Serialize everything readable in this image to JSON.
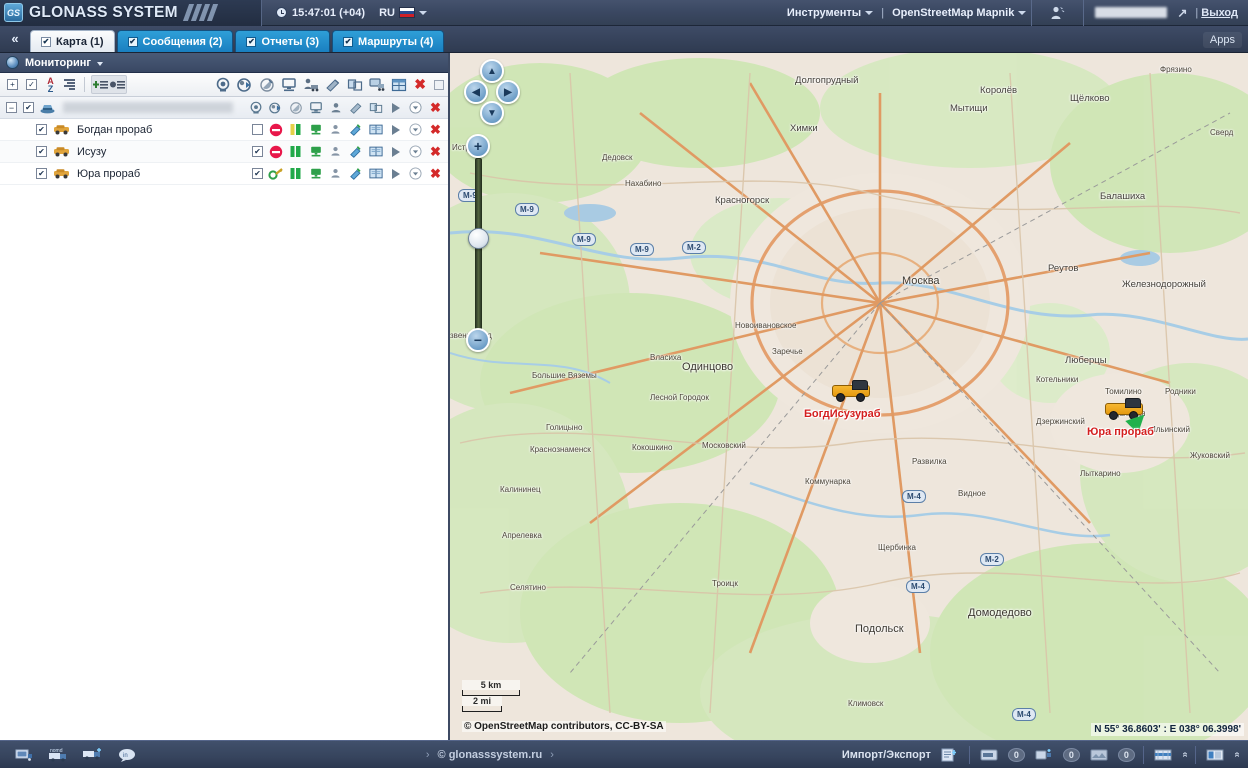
{
  "header": {
    "logo_text": "GLONASS SYSTEM",
    "logo_badge": "GS",
    "clock": "15:47:01 (+04)",
    "clock_icon": "clock-icon",
    "language": "RU",
    "flag_icon": "russia-flag-icon",
    "tools_menu": "Инструменты",
    "menu_divider": "|",
    "map_source_menu": "OpenStreetMap Mapnik",
    "user_tool_icon": "user-settings-icon",
    "user_name_redacted": "",
    "expand_icon": "expand-arrow-icon",
    "logout": "Выход"
  },
  "tabbar": {
    "collapse_icon": "collapse-left-icon",
    "tabs": [
      {
        "label": "Карта (1)",
        "checked": "✔",
        "active": true
      },
      {
        "label": "Сообщения (2)",
        "checked": "✔",
        "active": false
      },
      {
        "label": "Отчеты (3)",
        "checked": "✔",
        "active": false
      },
      {
        "label": "Маршруты (4)",
        "checked": "✔",
        "active": false
      }
    ],
    "apps_label": "Apps"
  },
  "panel": {
    "title": "Мониторинг",
    "globe_icon": "globe-icon",
    "caret_icon": "caret-down-icon",
    "toolbar_left": [
      {
        "name": "expand-all-button",
        "glyph": "⊞"
      },
      {
        "name": "select-all-checkbox-button",
        "glyph": "✔"
      },
      {
        "name": "sort-az-button",
        "glyph": "AZ"
      },
      {
        "name": "group-lines-button",
        "glyph": "lines"
      }
    ],
    "toolbar_groups": [
      {
        "name": "add-item-button",
        "glyph": "+"
      },
      {
        "name": "filter-item-button",
        "glyph": "●"
      }
    ],
    "toolbar_right": [
      {
        "name": "camera-monitor-icon"
      },
      {
        "name": "command-send-icon"
      },
      {
        "name": "satellite-antenna-icon"
      },
      {
        "name": "monitor-screen-icon"
      },
      {
        "name": "driver-truck-icon"
      },
      {
        "name": "fuel-sensor-icon"
      },
      {
        "name": "windows-copy-icon"
      },
      {
        "name": "truck-screen-icon"
      },
      {
        "name": "table-grid-icon"
      },
      {
        "name": "delete-all-icon"
      },
      {
        "name": "resize-corner-icon"
      }
    ]
  },
  "tree": {
    "group": {
      "expander": "−",
      "checked": "✔",
      "icon": "group-vehicles-icon",
      "name_redacted": "",
      "icons": [
        "camera-icon",
        "command-icon",
        "antenna-icon",
        "monitor-icon",
        "driver-icon",
        "fuel-icon",
        "copy-icon",
        "play-icon",
        "dropdown-icon",
        "delete-icon"
      ]
    },
    "items": [
      {
        "checked": "✔",
        "icon": "vehicle-icon",
        "label": "Богдан прораб",
        "second_checkbox": "",
        "status": "blocked",
        "status_icon": "no-entry-icon",
        "bars_icon": "signal-bars-icon",
        "monitor_icon": "monitor-green-icon",
        "driver_icon": "driver-icon",
        "fuel_icon": "fuel-sensor-icon",
        "book_icon": "book-open-icon",
        "play_icon": "play-icon",
        "dropdown_icon": "dropdown-icon",
        "delete_icon": "delete-icon"
      },
      {
        "checked": "✔",
        "icon": "vehicle-icon",
        "label": "Исузу",
        "second_checkbox": "✔",
        "status": "blocked",
        "status_icon": "no-entry-icon",
        "bars_icon": "signal-bars-icon",
        "monitor_icon": "monitor-green-icon",
        "driver_icon": "driver-icon",
        "fuel_icon": "fuel-sensor-icon",
        "book_icon": "book-open-icon",
        "play_icon": "play-icon",
        "dropdown_icon": "dropdown-icon",
        "delete_icon": "delete-icon"
      },
      {
        "checked": "✔",
        "icon": "vehicle-icon",
        "label": "Юра прораб",
        "second_checkbox": "✔",
        "status": "active",
        "status_icon": "key-green-icon",
        "bars_icon": "signal-bars-icon",
        "monitor_icon": "monitor-green-icon",
        "driver_icon": "driver-icon",
        "fuel_icon": "fuel-sensor-icon",
        "book_icon": "book-open-icon",
        "play_icon": "play-icon",
        "dropdown_icon": "dropdown-icon",
        "delete_icon": "delete-icon"
      }
    ]
  },
  "map": {
    "controls": {
      "pan_up": "▲",
      "pan_left": "◀",
      "pan_right": "▶",
      "pan_down": "▼",
      "zoom_in": "+",
      "zoom_out": "−"
    },
    "scale_km": "5 km",
    "scale_mi": "2 mi",
    "attribution": "© OpenStreetMap contributors, CC-BY-SA",
    "coordinates": "N 55° 36.8603' : E 038° 06.3998'",
    "markers": [
      {
        "label": "БогдИсузураб",
        "icon": "truck-marker-icon"
      },
      {
        "label": "Юра прораб",
        "icon": "truck-marker-icon",
        "heading_icon": "green-arrow-icon"
      }
    ],
    "road_shields": [
      "М-9",
      "М-9",
      "М-9",
      "М-9",
      "М-2",
      "М-4",
      "М-2",
      "М-4",
      "М-4"
    ],
    "labels": [
      "Долгопрудный",
      "Королёв",
      "Щёлково",
      "Фрязино",
      "Мытищи",
      "Химки",
      "Сверд",
      "Дедовск",
      "Нахабино",
      "Красногорск",
      "Балашиха",
      "Москва",
      "Реутов",
      "Железнодорожный",
      "Новоивановское",
      "Заречье",
      "Люберцы",
      "Котельники",
      "Томилино",
      "Родники",
      "Власиха",
      "Одинцово",
      "Дзержинский",
      "Удельная",
      "Ильинский",
      "Жуковский",
      "Голицыно",
      "Большие Вяземы",
      "Лесной Городок",
      "Краснознаменск",
      "Кокошкино",
      "Московский",
      "Развилка",
      "Лыткарино",
      "Калининец",
      "Коммунарка",
      "Видное",
      "Апрелевка",
      "Селятино",
      "Щербинка",
      "Троицк",
      "Подольск",
      "Домодедово",
      "Климовск",
      "Истра",
      "звенигород"
    ]
  },
  "bottombar": {
    "left_icons": [
      {
        "name": "vehicle-list-icon"
      },
      {
        "name": "vehicle-nomad-icon",
        "badge": "nomad"
      },
      {
        "name": "vehicle-add-icon"
      },
      {
        "name": "message-bubble-icon"
      }
    ],
    "site_label": "© glonasssystem.ru",
    "chev_left": "›",
    "chev_right": "›",
    "import_export": "Импорт/Экспорт",
    "import_export_icon": "import-export-icon",
    "counters": [
      {
        "icon": "message-counter-icon",
        "count": "0"
      },
      {
        "icon": "notification-counter-icon",
        "count": "0"
      },
      {
        "icon": "event-counter-icon",
        "count": "0"
      }
    ],
    "panels": [
      {
        "icon": "timeline-panel-icon",
        "chevron": "«"
      },
      {
        "icon": "blocks-panel-icon",
        "chevron": "«"
      }
    ]
  }
}
